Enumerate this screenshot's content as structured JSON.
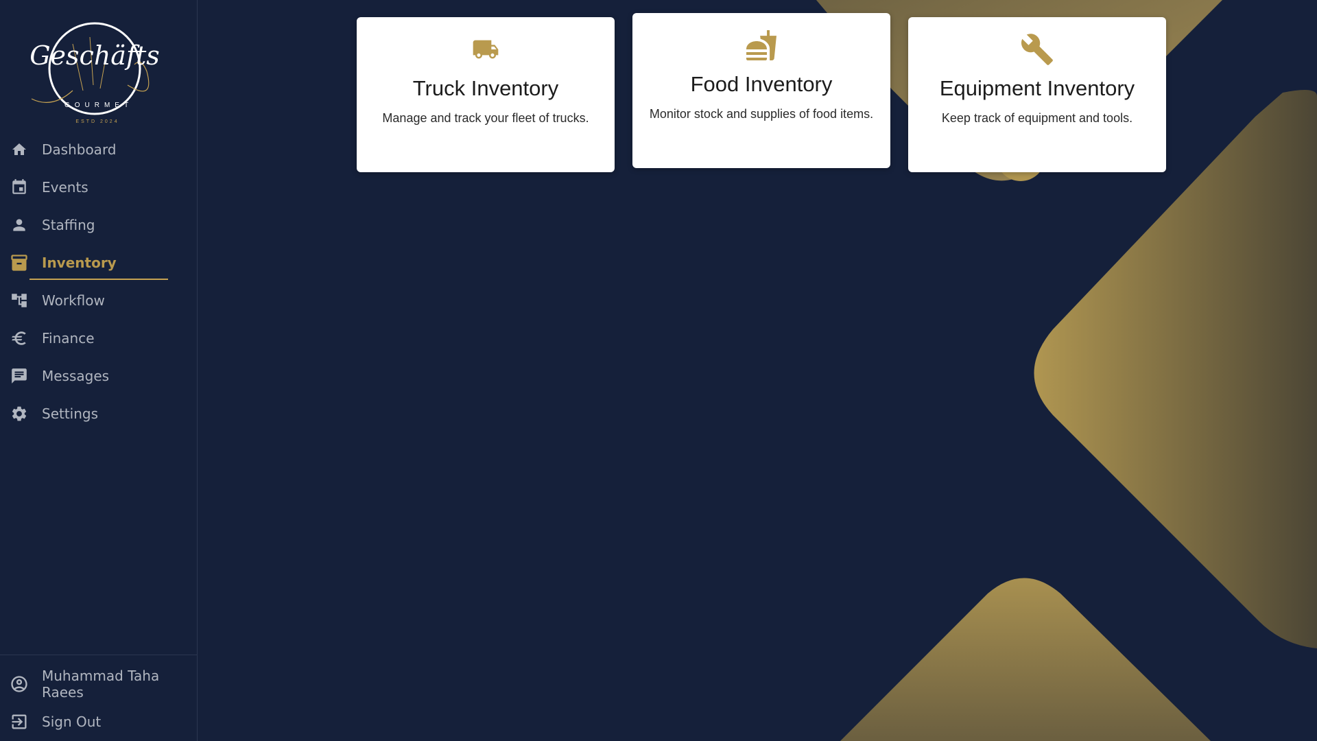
{
  "app": {
    "logo_script": "Geschäfts",
    "logo_subtitle": "GOURMET",
    "logo_estd": "ESTD 2024"
  },
  "colors": {
    "background": "#15203a",
    "accent": "#b99a4e",
    "nav_text": "#b1b6c0",
    "card_bg": "#ffffff"
  },
  "sidebar": {
    "items": [
      {
        "label": "Dashboard",
        "icon": "home-icon"
      },
      {
        "label": "Events",
        "icon": "calendar-icon"
      },
      {
        "label": "Staffing",
        "icon": "person-icon"
      },
      {
        "label": "Inventory",
        "icon": "archive-icon",
        "active": true
      },
      {
        "label": "Workflow",
        "icon": "workflow-icon"
      },
      {
        "label": "Finance",
        "icon": "euro-icon"
      },
      {
        "label": "Messages",
        "icon": "message-icon"
      },
      {
        "label": "Settings",
        "icon": "gear-icon"
      }
    ],
    "bottom": [
      {
        "label": "Muhammad Taha Raees",
        "icon": "account-circle-icon"
      },
      {
        "label": "Sign Out",
        "icon": "sign-out-icon"
      }
    ]
  },
  "main": {
    "cards": [
      {
        "title": "Truck Inventory",
        "description": "Manage and track your fleet of trucks.",
        "icon": "truck-icon"
      },
      {
        "title": "Food Inventory",
        "description": "Monitor stock and supplies of food items.",
        "icon": "fastfood-icon"
      },
      {
        "title": "Equipment Inventory",
        "description": "Keep track of equipment and tools.",
        "icon": "wrench-icon"
      }
    ]
  }
}
